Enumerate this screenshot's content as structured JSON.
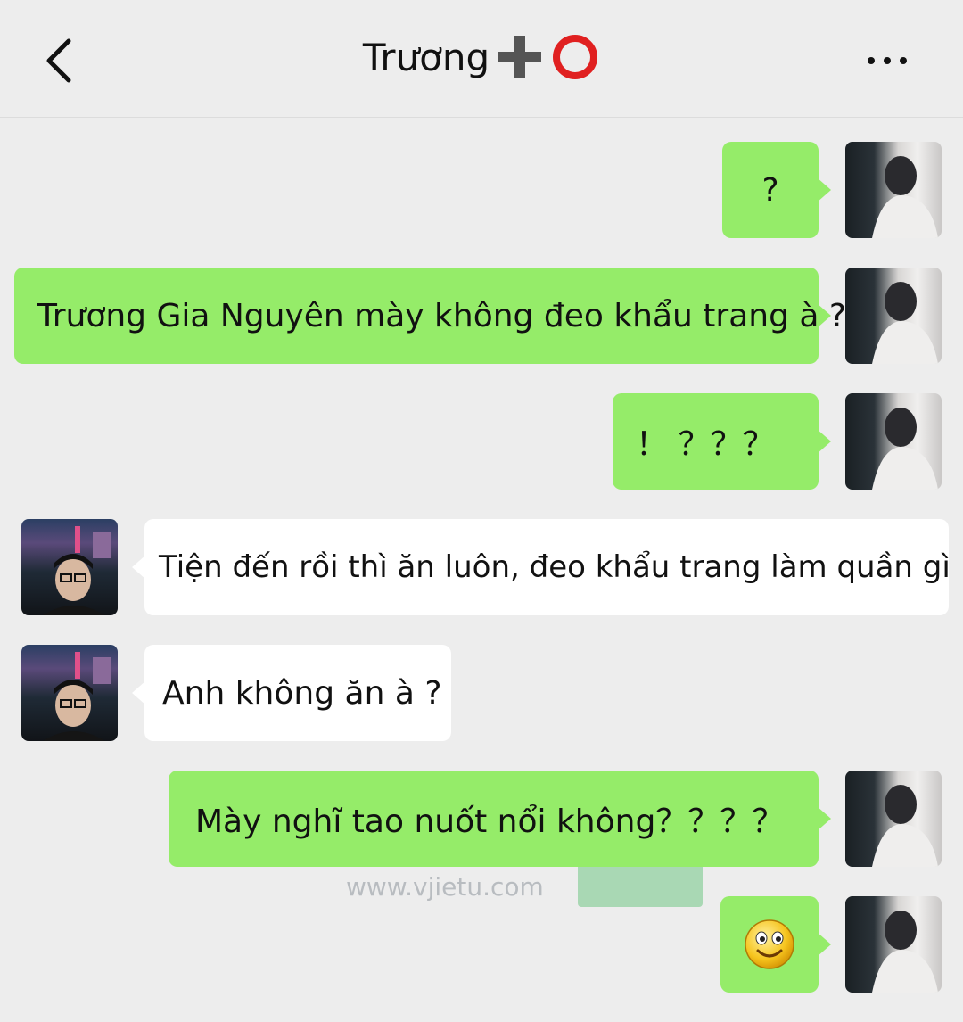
{
  "header": {
    "title": "Trương",
    "back_icon": "chevron-left-icon",
    "more_icon": "more-dots-icon",
    "title_emoji": [
      "heavy-plus-icon",
      "hollow-red-circle-icon"
    ]
  },
  "colors": {
    "background": "#ededed",
    "my_bubble": "#95ec69",
    "their_bubble": "#ffffff"
  },
  "messages": [
    {
      "sender": "me",
      "text": "?"
    },
    {
      "sender": "me",
      "text": "Trương Gia Nguyên mày không đeo khẩu trang à ?"
    },
    {
      "sender": "me",
      "text": "！ ？？？"
    },
    {
      "sender": "them",
      "text": "Tiện đến rồi thì ăn luôn, đeo khẩu trang làm quần gì"
    },
    {
      "sender": "them",
      "text": "Anh không ăn à ?"
    },
    {
      "sender": "me",
      "text": "Mày nghĩ tao nuốt nổi không？？？？"
    },
    {
      "sender": "me",
      "text": "",
      "emoji": "smiley-face-icon"
    }
  ],
  "watermark": "www.vjietu.com"
}
